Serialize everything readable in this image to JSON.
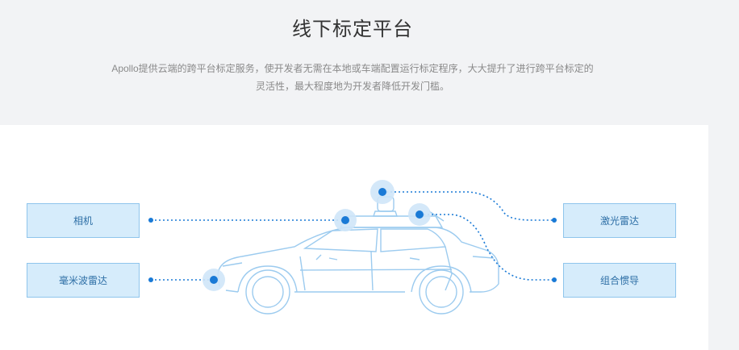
{
  "page": {
    "title": "线下标定平台",
    "description_line1": "Apollo提供云端的跨平台标定服务，使开发者无需在本地或车端配置运行标定程序，大大提升了进行跨平台标定的",
    "description_line2": "灵活性，最大程度地为开发者降低开发门槛。"
  },
  "sensors": {
    "camera": "相机",
    "mmw_radar": "毫米波雷达",
    "lidar": "激光雷达",
    "ins": "组合惯导"
  },
  "colors": {
    "accent": "#1a7ad6",
    "line": "#9ccbef",
    "box_fill": "#d6ecfb",
    "box_border": "#8fc5ec"
  }
}
